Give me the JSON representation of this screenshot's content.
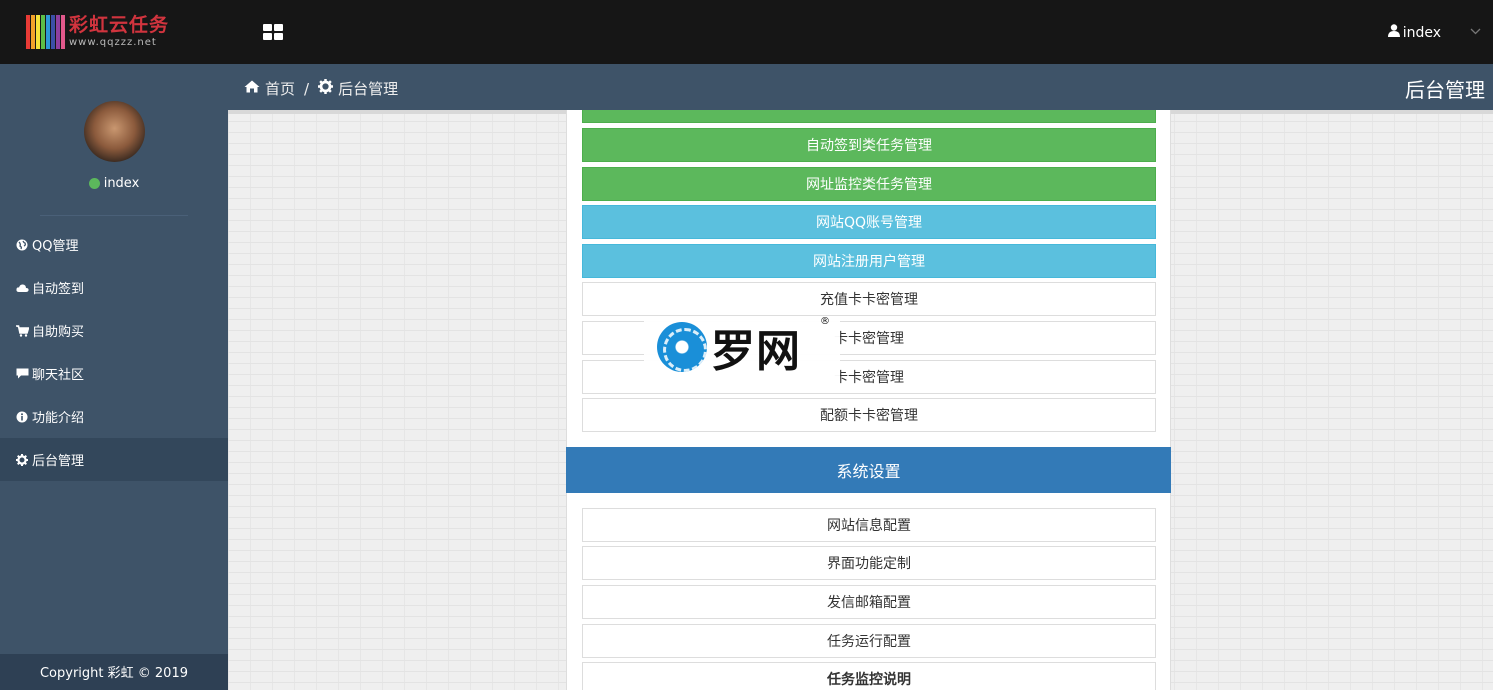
{
  "logo": {
    "title": "彩虹云任务",
    "url": "www.qqzzz.net",
    "stripe_colors": [
      "#e83b36",
      "#f1a22a",
      "#f5e33b",
      "#5cbf47",
      "#2d9ad8",
      "#3c4fa8",
      "#8e3fa0",
      "#e2598c"
    ]
  },
  "topbar": {
    "menu_icon": "grid-icon",
    "user_name": "index",
    "user_icon": "user-icon",
    "caret_icon": "chevron-down-icon"
  },
  "profile": {
    "name": "index",
    "status_color": "#5cb85c"
  },
  "sidebar": {
    "items": [
      {
        "label": "QQ管理",
        "icon": "globe-icon",
        "active": false
      },
      {
        "label": "自动签到",
        "icon": "cloud-icon",
        "active": false
      },
      {
        "label": "自助购买",
        "icon": "cart-icon",
        "active": false
      },
      {
        "label": "聊天社区",
        "icon": "comment-icon",
        "active": false
      },
      {
        "label": "功能介绍",
        "icon": "info-icon",
        "active": false
      },
      {
        "label": "后台管理",
        "icon": "gear-icon",
        "active": true
      }
    ],
    "copyright": "Copyright 彩虹 © 2019"
  },
  "breadcrumb": {
    "home": "首页",
    "separator": "/",
    "current": "后台管理"
  },
  "page_heading": "后台管理",
  "task_buttons": [
    {
      "label": "自动签到类任务管理",
      "style": "green"
    },
    {
      "label": "网址监控类任务管理",
      "style": "green"
    },
    {
      "label": "网站QQ账号管理",
      "style": "blue"
    },
    {
      "label": "网站注册用户管理",
      "style": "blue"
    },
    {
      "label": "充值卡卡密管理",
      "style": "white"
    },
    {
      "label": "卡卡密管理",
      "style": "white"
    },
    {
      "label": "卡卡密管理",
      "style": "white"
    },
    {
      "label": "配额卡卡密管理",
      "style": "white"
    }
  ],
  "system_section": {
    "title": "系统设置",
    "buttons": [
      {
        "label": "网站信息配置"
      },
      {
        "label": "界面功能定制"
      },
      {
        "label": "发信邮箱配置"
      },
      {
        "label": "任务运行配置"
      },
      {
        "label": "任务监控说明"
      }
    ]
  },
  "watermark": {
    "text": "罗网",
    "mark": "®"
  },
  "colors": {
    "sidebar": "#3e5368",
    "topbar": "#161616",
    "green": "#5cb85c",
    "blue": "#5bc0de",
    "section": "#337ab7"
  }
}
